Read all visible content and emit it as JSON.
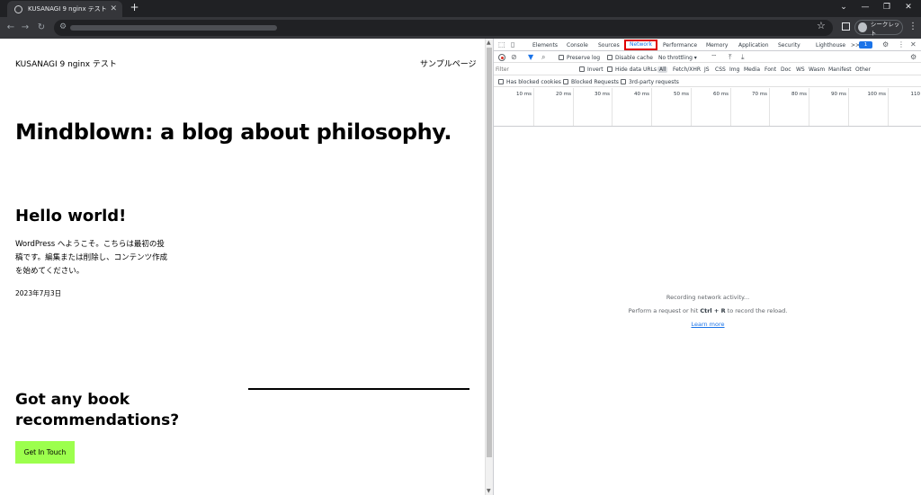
{
  "browser": {
    "tab_title": "KUSANAGI 9 nginx テスト",
    "new_tab": "+",
    "incognito_label": "シークレット"
  },
  "page": {
    "site_title": "KUSANAGI 9 nginx テスト",
    "nav_link": "サンプルページ",
    "hero_heading": "Mindblown: a blog about philosophy.",
    "post": {
      "title": "Hello world!",
      "excerpt": "WordPress へようこそ。こちらは最初の投稿です。編集または削除し、コンテンツ作成を始めてください。",
      "date": "2023年7月3日"
    },
    "cta": {
      "heading": "Got any book recommendations?",
      "button_label": "Get In Touch",
      "button_color": "#9cff4d"
    }
  },
  "devtools": {
    "tabs": [
      "Elements",
      "Console",
      "Sources",
      "Network",
      "Performance",
      "Memory",
      "Application",
      "Security",
      "Lighthouse"
    ],
    "active_tab": "Network",
    "more_tabs": ">>",
    "issues_badge": "1",
    "toolbar": {
      "preserve_log": "Preserve log",
      "disable_cache": "Disable cache",
      "throttling": "No throttling"
    },
    "filter_placeholder": "Filter",
    "filter_options": {
      "invert": "Invert",
      "hide_data_urls": "Hide data URLs"
    },
    "type_filters": [
      "All",
      "Fetch/XHR",
      "JS",
      "CSS",
      "Img",
      "Media",
      "Font",
      "Doc",
      "WS",
      "Wasm",
      "Manifest",
      "Other"
    ],
    "extra_filters": [
      "Has blocked cookies",
      "Blocked Requests",
      "3rd-party requests"
    ],
    "timeline_ticks": [
      "10 ms",
      "20 ms",
      "30 ms",
      "40 ms",
      "50 ms",
      "60 ms",
      "70 ms",
      "80 ms",
      "90 ms",
      "100 ms",
      "110"
    ],
    "empty_state": {
      "line1": "Recording network activity...",
      "line2_prefix": "Perform a request or hit ",
      "shortcut": "Ctrl + R",
      "line2_suffix": " to record the reload.",
      "learn_more": "Learn more"
    },
    "highlight_color": "#e00000"
  }
}
